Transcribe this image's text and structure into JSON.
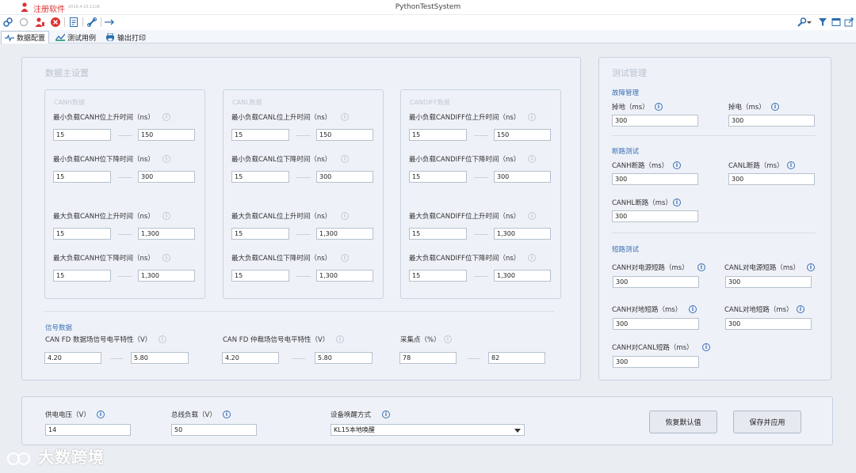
{
  "titlebar": {
    "app_name": "注册软件",
    "version": "2016.4.10.1118",
    "window_title": "PythonTestSystem"
  },
  "toolbar": {
    "left_icons": [
      "link-icon",
      "refresh-icon",
      "user-icon",
      "close-circle-icon",
      "document-icon",
      "chain-icon",
      "usb-icon"
    ],
    "right_icons": [
      "wrench-icon",
      "filter-icon",
      "window-icon",
      "export-icon"
    ]
  },
  "tabs": [
    {
      "label": "数据配置",
      "icon": "wave-icon",
      "active": true
    },
    {
      "label": "测试用例",
      "icon": "chart-icon",
      "active": false
    },
    {
      "label": "输出打印",
      "icon": "printer-icon",
      "active": false
    }
  ],
  "data_settings": {
    "title": "数据主设置",
    "groups": [
      {
        "title": "CANH数据",
        "rows": [
          {
            "label": "最小负载CANH位上升时间（ns）",
            "v1": "15",
            "v2": "150"
          },
          {
            "label": "最小负载CANH位下降时间（ns）",
            "v1": "15",
            "v2": "300"
          },
          {
            "label": "最大负载CANH位上升时间（ns）",
            "v1": "15",
            "v2": "1,300"
          },
          {
            "label": "最大负载CANH位下降时间（ns）",
            "v1": "15",
            "v2": "1,300"
          }
        ]
      },
      {
        "title": "CANL数据",
        "rows": [
          {
            "label": "最小负载CANL位上升时间（ns）",
            "v1": "15",
            "v2": "150"
          },
          {
            "label": "最小负载CANL位下降时间（ns）",
            "v1": "15",
            "v2": "300"
          },
          {
            "label": "最大负载CANL位上升时间（ns）",
            "v1": "15",
            "v2": "1,300"
          },
          {
            "label": "最大负载CANL位下降时间（ns）",
            "v1": "15",
            "v2": "1,300"
          }
        ]
      },
      {
        "title": "CANDIFF数据",
        "rows": [
          {
            "label": "最小负载CANDIFF位上升时间（ns）",
            "v1": "15",
            "v2": "150"
          },
          {
            "label": "最小负载CANDIFF位下降时间（ns）",
            "v1": "15",
            "v2": "300"
          },
          {
            "label": "最大负载CANDIFF位上升时间（ns）",
            "v1": "15",
            "v2": "1,300"
          },
          {
            "label": "最大负载CANDIFF位下降时间（ns）",
            "v1": "15",
            "v2": "1,300"
          }
        ]
      }
    ],
    "signal": {
      "title": "信号数据",
      "items": [
        {
          "label": "CAN FD 数据场信号电平特性（V）",
          "v1": "4.20",
          "v2": "5.80"
        },
        {
          "label": "CAN FD 仲裁场信号电平特性（V）",
          "v1": "4.20",
          "v2": "5.80"
        },
        {
          "label": "采集点（%）",
          "v1": "78",
          "v2": "82"
        }
      ]
    }
  },
  "test_management": {
    "title": "测试管理",
    "fault": {
      "title": "故障管理",
      "items": [
        {
          "label": "掉地（ms）",
          "value": "300"
        },
        {
          "label": "掉电（ms）",
          "value": "300"
        }
      ]
    },
    "open": {
      "title": "断路测试",
      "items": [
        {
          "label": "CANH断路（ms）",
          "value": "300"
        },
        {
          "label": "CANL断路（ms）",
          "value": "300"
        },
        {
          "label": "CANHL断路（ms）",
          "value": "300"
        }
      ]
    },
    "short": {
      "title": "短路测试",
      "items": [
        {
          "label": "CANH对电源短路（ms）",
          "value": "300"
        },
        {
          "label": "CANL对电源短路（ms）",
          "value": "300"
        },
        {
          "label": "CANH对地短路（ms）",
          "value": "300"
        },
        {
          "label": "CANL对地短路（ms）",
          "value": "300"
        },
        {
          "label": "CANH对CANL短路（ms）",
          "value": "300"
        }
      ]
    }
  },
  "bottom": {
    "supply_voltage": {
      "label": "供电电压（V）",
      "value": "14"
    },
    "bus_load": {
      "label": "总线负载（V）",
      "value": "50"
    },
    "wake_mode": {
      "label": "设备唤醒方式",
      "value": "KL15本地唤醒"
    },
    "restore_label": "恢复默认值",
    "save_label": "保存并应用"
  },
  "watermark": "大数跨境"
}
